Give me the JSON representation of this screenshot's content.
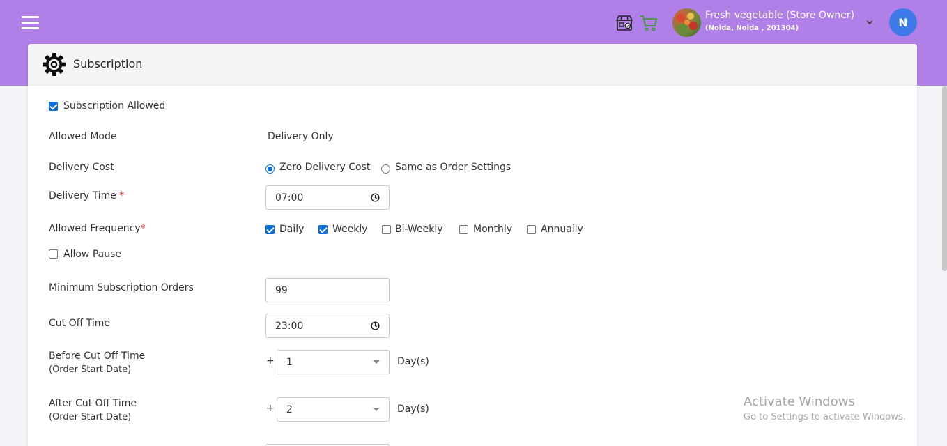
{
  "header": {
    "store_name": "Fresh vegetable (Store Owner)",
    "store_address": "(Noida, Noida , 201304)",
    "user_initial": "N",
    "icons": [
      "menu-icon",
      "store-icon",
      "cart-icon",
      "chevron-down-icon"
    ],
    "brand_color": "#b07fe8"
  },
  "card": {
    "title": "Subscription"
  },
  "form": {
    "subscription_allowed": {
      "label": "Subscription Allowed",
      "checked": true
    },
    "allowed_mode": {
      "label": "Allowed Mode",
      "value": "Delivery Only"
    },
    "delivery_cost": {
      "label": "Delivery Cost",
      "options": [
        {
          "label": "Zero Delivery Cost",
          "selected": true
        },
        {
          "label": "Same as Order Settings",
          "selected": false
        }
      ]
    },
    "delivery_time": {
      "label": "Delivery Time",
      "required_mark": "*",
      "value": "07:00"
    },
    "allowed_frequency": {
      "label": "Allowed Frequency",
      "required_mark": "*",
      "options": [
        {
          "label": "Daily",
          "checked": true
        },
        {
          "label": "Weekly",
          "checked": true
        },
        {
          "label": "Bi-Weekly",
          "checked": false
        },
        {
          "label": "Monthly",
          "checked": false
        },
        {
          "label": "Annually",
          "checked": false
        }
      ]
    },
    "allow_pause": {
      "label": "Allow Pause",
      "checked": false
    },
    "min_orders": {
      "label": "Minimum Subscription Orders",
      "value": "99"
    },
    "cut_off_time": {
      "label": "Cut Off Time",
      "value": "23:00"
    },
    "before_cut_off": {
      "label": "Before Cut Off Time",
      "sub": "(Order Start Date)",
      "prefix": "+",
      "value": "1",
      "unit": "Day(s)"
    },
    "after_cut_off": {
      "label": "After Cut Off Time",
      "sub": "(Order Start Date)",
      "prefix": "+",
      "value": "2",
      "unit": "Day(s)"
    }
  },
  "watermark": {
    "title": "Activate Windows",
    "subtitle": "Go to Settings to activate Windows."
  }
}
